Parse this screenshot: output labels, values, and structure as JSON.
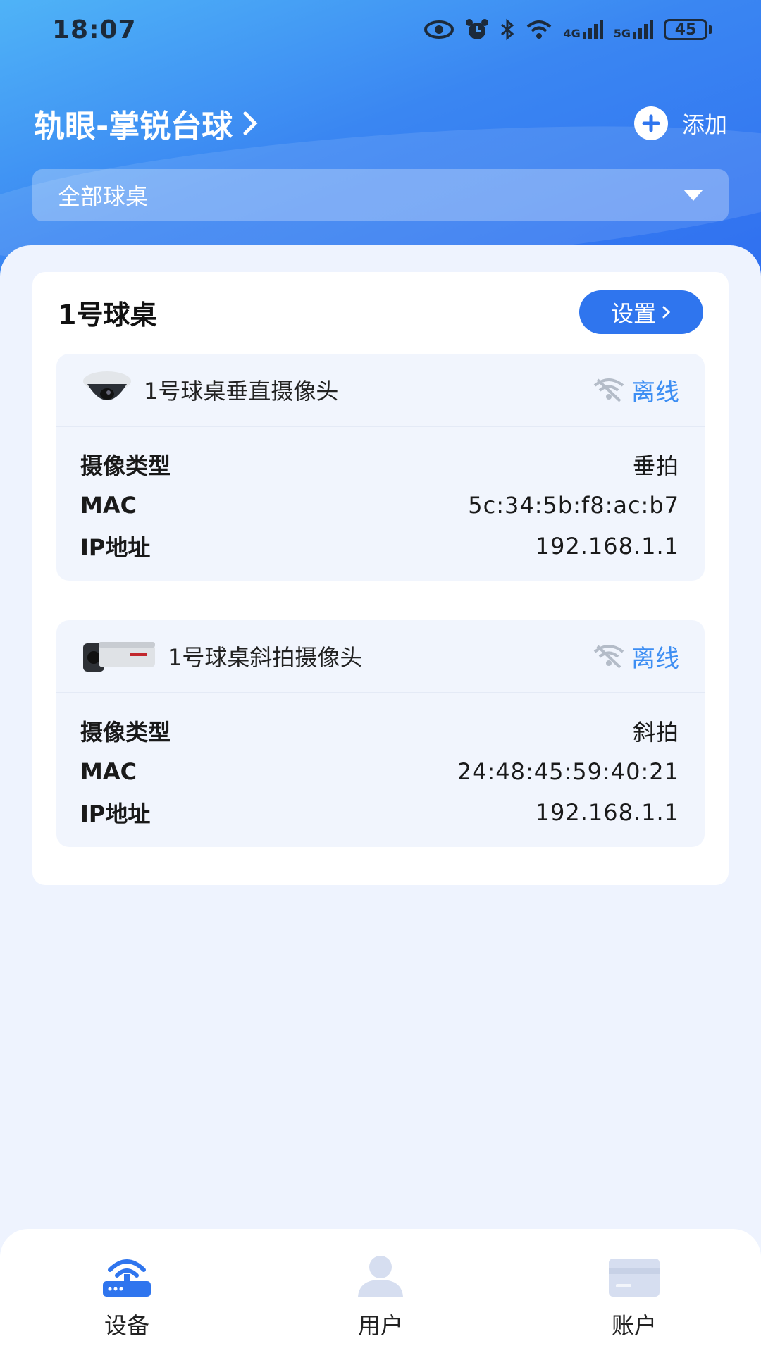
{
  "status_bar": {
    "time": "18:07",
    "net1": "4G",
    "net2": "5G",
    "battery": "45"
  },
  "header": {
    "store_title": "轨眼-掌锐台球",
    "add_label": "添加"
  },
  "filter": {
    "selected": "全部球桌"
  },
  "table": {
    "name": "1号球桌",
    "settings_label": "设置",
    "cameras": [
      {
        "name": "1号球桌垂直摄像头",
        "status": "离线",
        "icon": "dome-camera-icon",
        "rows": [
          {
            "label": "摄像类型",
            "value": "垂拍"
          },
          {
            "label": "MAC",
            "value": "5c:34:5b:f8:ac:b7"
          },
          {
            "label": "IP地址",
            "value": "192.168.1.1"
          }
        ]
      },
      {
        "name": "1号球桌斜拍摄像头",
        "status": "离线",
        "icon": "bullet-camera-icon",
        "rows": [
          {
            "label": "摄像类型",
            "value": "斜拍"
          },
          {
            "label": "MAC",
            "value": "24:48:45:59:40:21"
          },
          {
            "label": "IP地址",
            "value": "192.168.1.1"
          }
        ]
      }
    ]
  },
  "tabbar": {
    "tabs": [
      {
        "label": "设备",
        "icon": "router-icon",
        "active": true
      },
      {
        "label": "用户",
        "icon": "user-icon",
        "active": false
      },
      {
        "label": "账户",
        "icon": "card-icon",
        "active": false
      }
    ]
  },
  "colors": {
    "primary": "#2f75ee",
    "offline": "#3d8ef3",
    "background": "#eef3fe"
  }
}
